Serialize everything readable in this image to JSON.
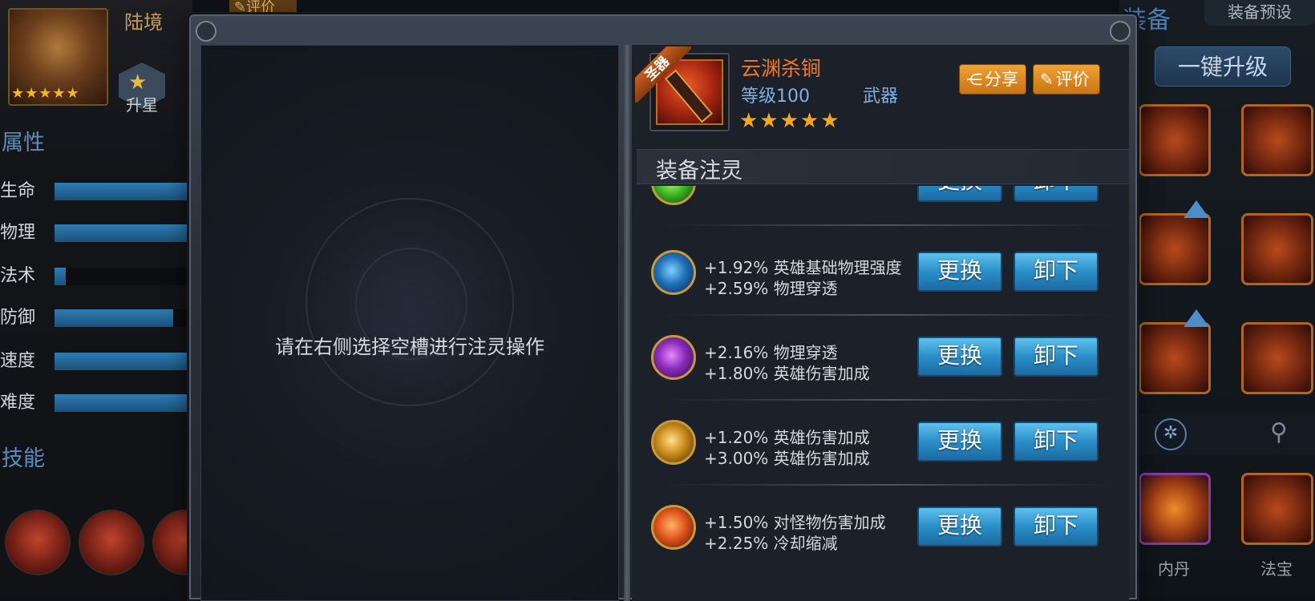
{
  "hero": {
    "name": "陆境",
    "stars": "★★★★★",
    "eval_tag": "评价",
    "star_up_label": "升星"
  },
  "attributes": {
    "title": "属性",
    "items": [
      {
        "label": "生命",
        "level": 1.0
      },
      {
        "label": "物理",
        "level": 1.0
      },
      {
        "label": "法术",
        "level": 0.08
      },
      {
        "label": "防御",
        "level": 0.86
      },
      {
        "label": "速度",
        "level": 1.0
      },
      {
        "label": "难度",
        "level": 1.0
      }
    ]
  },
  "skills": {
    "title": "技能"
  },
  "equipment_panel": {
    "title": "装备",
    "preset_label": "装备预设",
    "upgrade_all_label": "一键升级",
    "slot_labels": [
      "内丹",
      "法宝"
    ]
  },
  "modal": {
    "instruction": "请在右侧选择空槽进行注灵操作",
    "item": {
      "badge": "圣器",
      "name": "云渊杀锏",
      "level": "等级100",
      "type": "武器",
      "stars": "★★★★★",
      "share_label": "分享",
      "rate_label": "评价"
    },
    "section_title": "装备注灵",
    "replace_label": "更换",
    "remove_label": "卸下",
    "spirits": [
      {
        "gem": "green",
        "stat1": "",
        "stat2": ""
      },
      {
        "gem": "blue",
        "stat1": "+1.92% 英雄基础物理强度",
        "stat2": "+2.59% 物理穿透"
      },
      {
        "gem": "purple",
        "stat1": "+2.16% 物理穿透",
        "stat2": "+1.80% 英雄伤害加成"
      },
      {
        "gem": "gold",
        "stat1": "+1.20% 英雄伤害加成",
        "stat2": "+3.00% 英雄伤害加成"
      },
      {
        "gem": "orange",
        "stat1": "+1.50% 对怪物伤害加成",
        "stat2": "+2.25% 冷却缩减"
      }
    ]
  },
  "colors": {
    "accent_blue": "#2a8fc8",
    "accent_orange": "#ef7a2a",
    "star_gold": "#f5a71d"
  }
}
